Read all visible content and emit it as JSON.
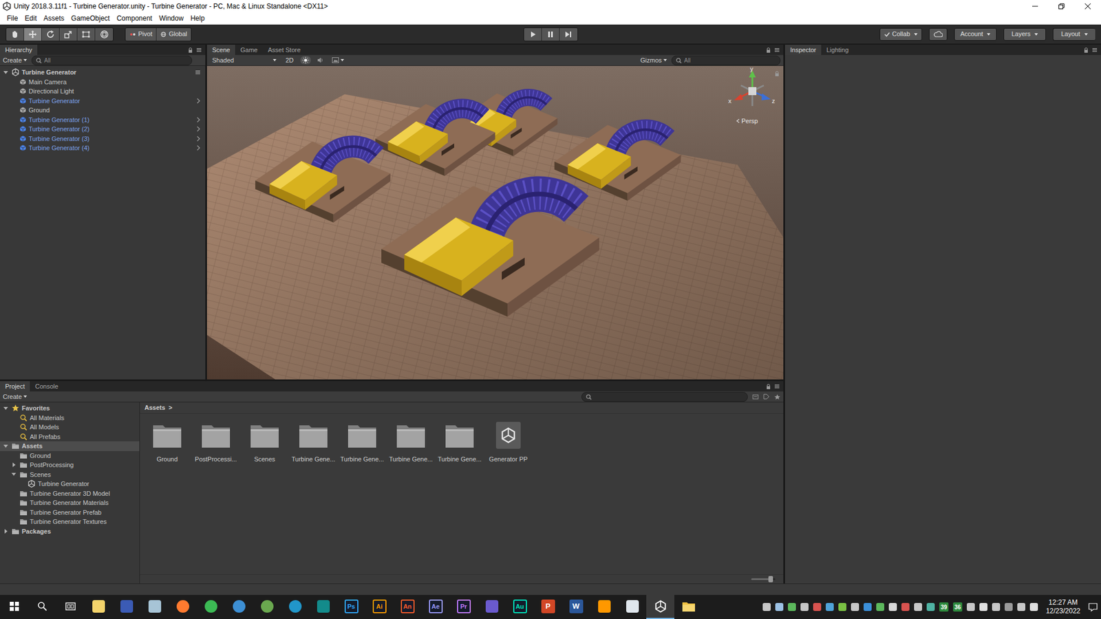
{
  "window": {
    "title": "Unity 2018.3.11f1 - Turbine Generator.unity - Turbine Generator - PC, Mac & Linux Standalone <DX11>"
  },
  "menu": [
    "File",
    "Edit",
    "Assets",
    "GameObject",
    "Component",
    "Window",
    "Help"
  ],
  "toolbar": {
    "tools": [
      {
        "kind": "hand",
        "selected": false
      },
      {
        "kind": "move",
        "selected": true
      },
      {
        "kind": "rotate",
        "selected": false
      },
      {
        "kind": "scale",
        "selected": false
      },
      {
        "kind": "rect",
        "selected": false
      },
      {
        "kind": "transform",
        "selected": false
      }
    ],
    "pivot": "Pivot",
    "global": "Global",
    "playback": [
      {
        "kind": "play",
        "on": false
      },
      {
        "kind": "pause",
        "on": false
      },
      {
        "kind": "step",
        "on": false
      }
    ],
    "collab": "Collab",
    "account": "Account",
    "layers": "Layers",
    "layout": "Layout"
  },
  "hierarchy": {
    "tab": "Hierarchy",
    "create": "Create",
    "search_placeholder": "All",
    "scene": "Turbine Generator",
    "expanded": true,
    "items": [
      {
        "name": "Main Camera",
        "kind": "object",
        "selected": false
      },
      {
        "name": "Directional Light",
        "kind": "object",
        "selected": false
      },
      {
        "name": "Turbine Generator",
        "kind": "prefab",
        "selected": false
      },
      {
        "name": "Ground",
        "kind": "object",
        "selected": false
      },
      {
        "name": "Turbine Generator (1)",
        "kind": "prefab",
        "selected": false
      },
      {
        "name": "Turbine Generator (2)",
        "kind": "prefab",
        "selected": false
      },
      {
        "name": "Turbine Generator (3)",
        "kind": "prefab",
        "selected": false
      },
      {
        "name": "Turbine Generator (4)",
        "kind": "prefab",
        "selected": false
      }
    ]
  },
  "scene_view": {
    "tabs": [
      {
        "label": "Scene",
        "selected": true
      },
      {
        "label": "Game",
        "selected": false
      },
      {
        "label": "Asset Store",
        "selected": false
      }
    ],
    "shading": "Shaded",
    "mode_2d": {
      "label": "2D",
      "on": false
    },
    "toggles": [
      {
        "kind": "lighting",
        "on": true
      },
      {
        "kind": "audio",
        "on": false
      },
      {
        "kind": "effects",
        "on": false
      }
    ],
    "gizmos": "Gizmos",
    "search_placeholder": "All",
    "axes": {
      "y": "y",
      "x": "x",
      "z": "z"
    },
    "projection": "Persp"
  },
  "inspector": {
    "tabs": [
      {
        "label": "Inspector",
        "selected": true
      },
      {
        "label": "Lighting",
        "selected": false
      }
    ]
  },
  "project": {
    "tabs": [
      {
        "label": "Project",
        "selected": true
      },
      {
        "label": "Console",
        "selected": false
      }
    ],
    "create": "Create",
    "tree": [
      {
        "label": "Favorites",
        "kind": "favorites",
        "expanded": true,
        "selected": false,
        "children": [
          {
            "label": "All Materials",
            "kind": "search",
            "selected": false
          },
          {
            "label": "All Models",
            "kind": "search",
            "selected": false
          },
          {
            "label": "All Prefabs",
            "kind": "search",
            "selected": false
          }
        ]
      },
      {
        "label": "Assets",
        "kind": "folder",
        "expanded": true,
        "selected": true,
        "children": [
          {
            "label": "Ground",
            "kind": "folder",
            "selected": false
          },
          {
            "label": "PostProcessing",
            "kind": "folder",
            "expanded": false,
            "selected": false
          },
          {
            "label": "Scenes",
            "kind": "folder",
            "expanded": true,
            "selected": false,
            "children": [
              {
                "label": "Turbine Generator",
                "kind": "scene",
                "selected": false
              }
            ]
          },
          {
            "label": "Turbine Generator 3D Model",
            "kind": "folder",
            "selected": false
          },
          {
            "label": "Turbine Generator Materials",
            "kind": "folder",
            "selected": false
          },
          {
            "label": "Turbine Generator Prefab",
            "kind": "folder",
            "selected": false
          },
          {
            "label": "Turbine Generator Textures",
            "kind": "folder",
            "selected": false
          }
        ]
      },
      {
        "label": "Packages",
        "kind": "folder",
        "expanded": false,
        "selected": false
      }
    ],
    "breadcrumb": {
      "label": "Assets",
      "separator": ">"
    },
    "assets": [
      {
        "label": "Ground",
        "kind": "folder"
      },
      {
        "label": "PostProcessi...",
        "kind": "folder"
      },
      {
        "label": "Scenes",
        "kind": "folder"
      },
      {
        "label": "Turbine Gene...",
        "kind": "folder"
      },
      {
        "label": "Turbine Gene...",
        "kind": "folder"
      },
      {
        "label": "Turbine Gene...",
        "kind": "folder"
      },
      {
        "label": "Turbine Gene...",
        "kind": "folder"
      },
      {
        "label": "Generator PP",
        "kind": "unity"
      }
    ],
    "zoom": {
      "level": 0.8
    }
  },
  "taskbar": {
    "apps": [
      {
        "kind": "start",
        "active": false
      },
      {
        "kind": "search",
        "active": false
      },
      {
        "kind": "taskview",
        "active": false
      },
      {
        "kind": "shape",
        "color": "#f3d36b",
        "active": false
      },
      {
        "kind": "shape",
        "color": "#3b5bb5",
        "active": false
      },
      {
        "kind": "shape",
        "color": "#a7c4d6",
        "active": false
      },
      {
        "kind": "circle",
        "color": "#ff7a2f",
        "active": false
      },
      {
        "kind": "circle",
        "color": "#3cba54",
        "active": false
      },
      {
        "kind": "circle",
        "color": "#3d8fd4",
        "active": false
      },
      {
        "kind": "circle",
        "color": "#6aa84f",
        "active": false
      },
      {
        "kind": "circle",
        "color": "#2196c9",
        "active": false
      },
      {
        "kind": "shape",
        "color": "#138b8b",
        "active": false
      },
      {
        "kind": "letters",
        "label": "Ps",
        "color": "#31a8ff",
        "active": false
      },
      {
        "kind": "letters",
        "label": "Ai",
        "color": "#ff9a00",
        "active": false
      },
      {
        "kind": "letters",
        "label": "An",
        "color": "#ff5b2a",
        "active": false
      },
      {
        "kind": "letters",
        "label": "Ae",
        "color": "#9999ff",
        "active": false
      },
      {
        "kind": "letters",
        "label": "Pr",
        "color": "#c17bff",
        "active": false
      },
      {
        "kind": "shape",
        "color": "#6a5acd",
        "active": false
      },
      {
        "kind": "letters",
        "label": "Au",
        "color": "#00e4bb",
        "active": false
      },
      {
        "kind": "tile",
        "label": "P",
        "color": "#d24726",
        "active": false
      },
      {
        "kind": "tile",
        "label": "W",
        "color": "#2b579a",
        "active": false
      },
      {
        "kind": "shape",
        "color": "#ff9800",
        "active": false
      },
      {
        "kind": "shape",
        "color": "#dfe6ec",
        "active": false
      },
      {
        "kind": "unity",
        "active": true
      },
      {
        "kind": "folder",
        "color": "#f0c040",
        "active": false
      }
    ],
    "tray_badges": [
      "39",
      "36"
    ],
    "time": "12:27 AM",
    "date": "12/23/2022"
  }
}
